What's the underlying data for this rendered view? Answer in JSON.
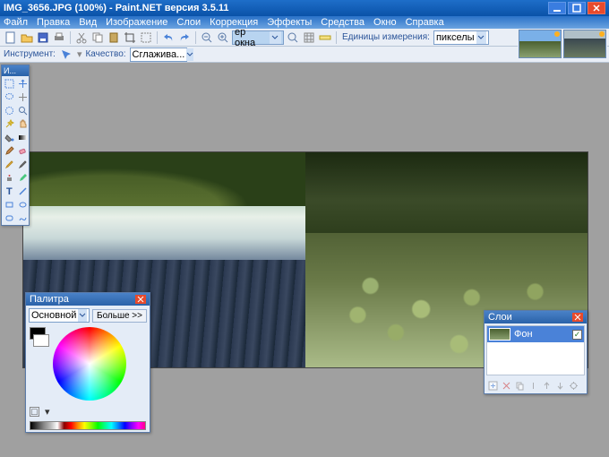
{
  "title": "IMG_3656.JPG (100%) - Paint.NET версия 3.5.11",
  "menu": [
    "Файл",
    "Правка",
    "Вид",
    "Изображение",
    "Слои",
    "Коррекция",
    "Эффекты",
    "Средства",
    "Окно",
    "Справка"
  ],
  "toolbar": {
    "fit_mode": "ер окна",
    "units_label": "Единицы измерения:",
    "units_value": "пикселы"
  },
  "subtoolbar": {
    "instrument_label": "Инструмент:",
    "quality_label": "Качество:",
    "quality_value": "Сглажива..."
  },
  "tools_title": "И...",
  "palette": {
    "title": "Палитра",
    "channel": "Основной",
    "more": "Больше >>"
  },
  "layers": {
    "title": "Слои",
    "item_name": "Фон"
  },
  "icons": {
    "new": "new",
    "open": "open",
    "save": "save",
    "print": "print",
    "cut": "cut",
    "copy": "copy",
    "paste": "paste",
    "crop": "crop",
    "deselect": "deselect",
    "undo": "undo",
    "redo": "redo",
    "zoomin": "zoomin",
    "zoomout": "zoomout",
    "grid": "grid",
    "ruler": "ruler"
  }
}
